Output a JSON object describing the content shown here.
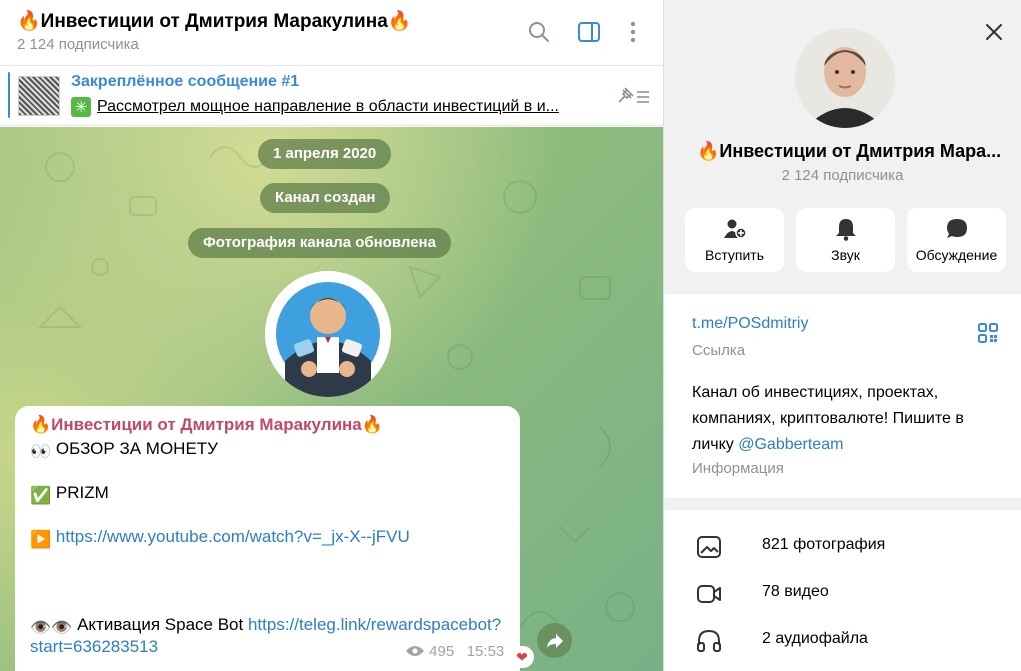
{
  "header": {
    "title": "🔥Инвестиции от Дмитрия Маракулина🔥",
    "subscribers": "2 124 подписчика",
    "icons": [
      "search-icon",
      "sidebar-toggle-icon",
      "more-vertical-icon"
    ]
  },
  "pinned": {
    "title": "Закреплённое сообщение #1",
    "emoji": "✳",
    "text": "Рассмотрел мощное направление в области инвестиций в и..."
  },
  "service": {
    "date": "1 апреля 2020",
    "created": "Канал создан",
    "photo_updated": "Фотография канала обновлена"
  },
  "message": {
    "author": "🔥Инвестиции от Дмитрия Маракулина🔥",
    "line1_emoji": "👀",
    "line1_text": "ОБЗОР ЗА МОНЕТУ",
    "line2_emoji": "✅",
    "line2_text": "PRIZM",
    "line3_emoji": "▶️",
    "line3_link": "https://www.youtube.com/watch?v=_jx-X--jFVU",
    "line4_emoji": "👁️👁️",
    "line4_text": "Активация Space Bot",
    "line4_link": "https://teleg.link/rewardspacebot?",
    "line5_link": "start=636283513",
    "views": "495",
    "time": "15:53",
    "reaction": "❤"
  },
  "profile": {
    "name": "🔥Инвестиции от Дмитрия Мара...",
    "subscribers": "2 124 подписчика",
    "actions": [
      {
        "label": "Вступить",
        "icon": "join-user-icon"
      },
      {
        "label": "Звук",
        "icon": "bell-icon"
      },
      {
        "label": "Обсуждение",
        "icon": "chat-bubble-icon"
      }
    ],
    "link": "t.me/POSdmitriy",
    "link_caption": "Ссылка",
    "description_text": "Канал об  инвестициях, проектах, компаниях, криптовалюте! Пишите в личку ",
    "description_mention": "@Gabberteam",
    "info_caption": "Информация",
    "media": [
      {
        "label": "821 фотография",
        "icon": "photo-icon"
      },
      {
        "label": "78 видео",
        "icon": "video-icon"
      },
      {
        "label": "2 аудиофайла",
        "icon": "headphones-icon"
      }
    ]
  },
  "colors": {
    "accent": "#3a8bd6",
    "author": "#c24a66",
    "link": "#2b7fc2",
    "muted": "#8c9299"
  }
}
